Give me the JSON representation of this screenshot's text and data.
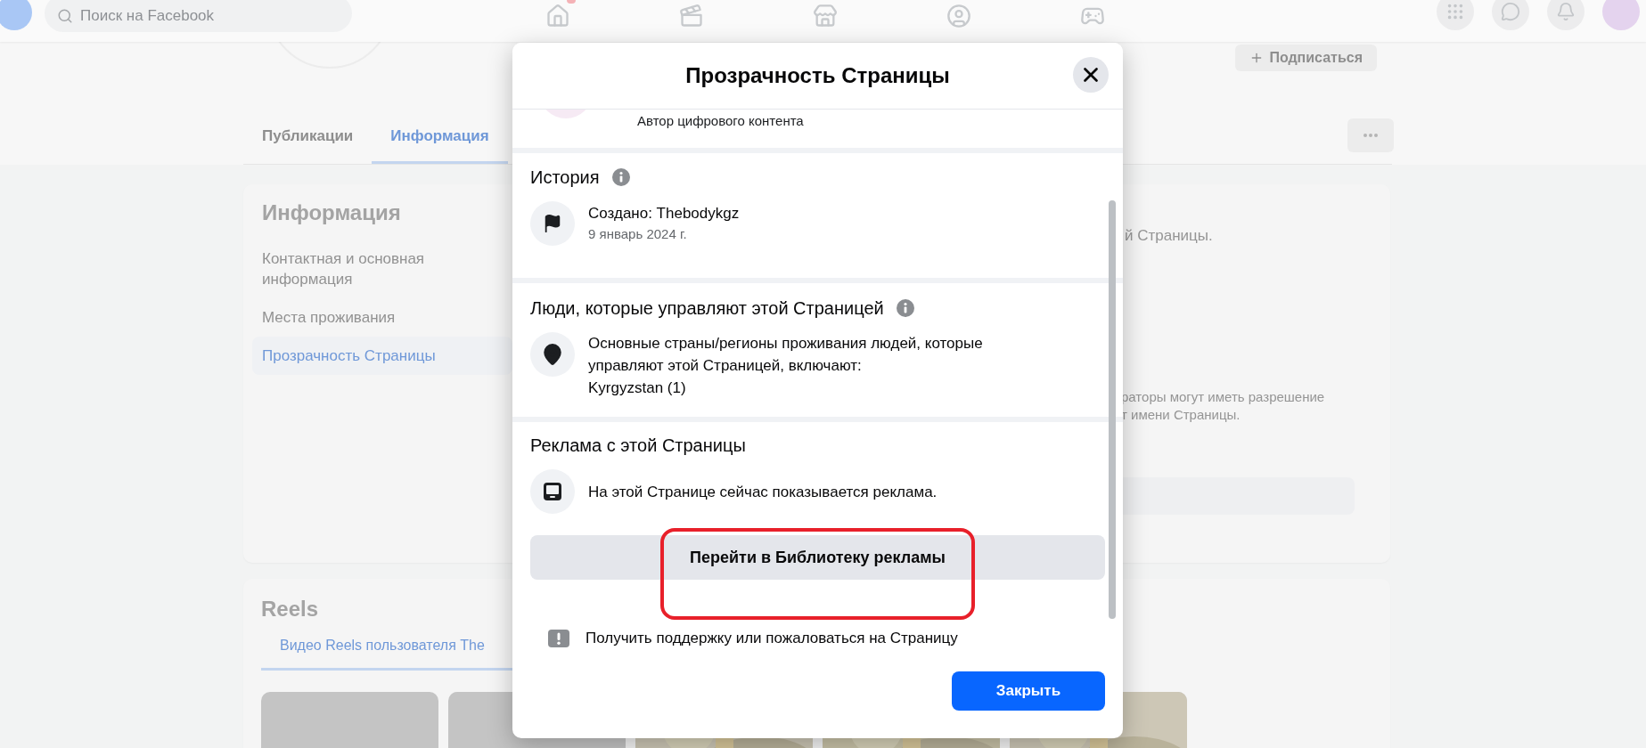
{
  "top_bar": {
    "search": {
      "placeholder": "Поиск на Facebook"
    }
  },
  "profile": {
    "follow_button": "Подписаться",
    "tabs": [
      {
        "label": "Публикации",
        "selected": false
      },
      {
        "label": "Информация",
        "selected": true
      }
    ]
  },
  "about_card": {
    "title": "Информация",
    "menu": [
      {
        "label": "Контактная и основная информация",
        "selected": false
      },
      {
        "label": "Места проживания",
        "selected": false
      },
      {
        "label": "Прозрачность Страницы",
        "selected": true
      }
    ],
    "fragments": [
      "й Страницы.",
      "раторы могут иметь разрешение",
      "т имени Страницы."
    ]
  },
  "reels": {
    "title": "Reels",
    "tab": {
      "label": "Видео Reels пользователя The",
      "selected": true
    },
    "thumbnails": [
      {
        "kind": "blank"
      },
      {
        "kind": "blank"
      },
      {
        "kind": "picture"
      },
      {
        "kind": "picture"
      },
      {
        "kind": "picture"
      }
    ]
  },
  "dialog": {
    "title": "Прозрачность Страницы",
    "page_category": "Автор цифрового контента",
    "sections": [
      {
        "title": "История",
        "info": true,
        "rows": [
          {
            "lines": [
              "Создано: Thebodykgz"
            ],
            "subtext": "9 январь 2024 г."
          }
        ]
      },
      {
        "title": "Люди, которые управляют этой Страницей",
        "info": true,
        "rows": [
          {
            "lines": [
              "Основные страны/регионы проживания людей, которые",
              "управляют этой Страницей, включают:",
              "Kyrgyzstan (1)"
            ]
          }
        ]
      },
      {
        "title": "Реклама с этой Страницы",
        "info": false,
        "rows": [
          {
            "lines": [
              "На этой Странице сейчас показывается реклама."
            ]
          }
        ],
        "button": {
          "label": "Перейти в Библиотеку рекламы",
          "highlighted": true
        }
      }
    ],
    "report_link": "Получить поддержку или пожаловаться на Страницу",
    "close_button": "Закрыть"
  }
}
